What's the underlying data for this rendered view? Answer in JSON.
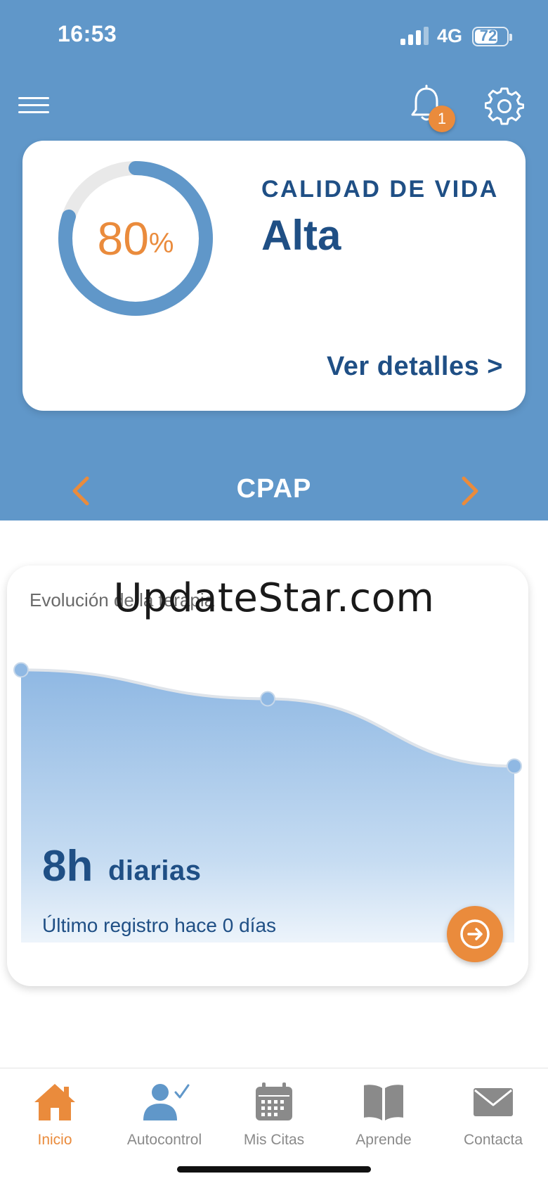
{
  "status_bar": {
    "time": "16:53",
    "network": "4G",
    "battery": "72",
    "battery_level": 0.72
  },
  "header": {
    "notification_count": "1"
  },
  "quality_card": {
    "title": "CALIDAD DE VIDA",
    "percent_value": "80",
    "percent_sign": "%",
    "percent": 80,
    "level": "Alta",
    "details_link": "Ver detalles >"
  },
  "therapy_selector": {
    "label": "CPAP"
  },
  "therapy_card": {
    "title": "Evolución de la terapia",
    "hours_value": "8h",
    "hours_unit": "diarias",
    "last_record": "Último registro hace 0 días"
  },
  "chart_data": {
    "type": "area",
    "title": "Evolución de la terapia",
    "values": [
      8.5,
      7.6,
      5.5
    ]
  },
  "watermark": "UpdateStar.com",
  "nav": {
    "items": [
      {
        "label": "Inicio",
        "icon": "home-icon",
        "active": true
      },
      {
        "label": "Autocontrol",
        "icon": "user-check-icon",
        "active": false
      },
      {
        "label": "Mis Citas",
        "icon": "calendar-icon",
        "active": false
      },
      {
        "label": "Aprende",
        "icon": "book-icon",
        "active": false
      },
      {
        "label": "Contacta",
        "icon": "mail-icon",
        "active": false
      }
    ]
  },
  "colors": {
    "primary": "#6097c9",
    "accent": "#ea8b3c",
    "text_dark": "#1f4f85",
    "nav_inactive": "#8a8a8a"
  }
}
